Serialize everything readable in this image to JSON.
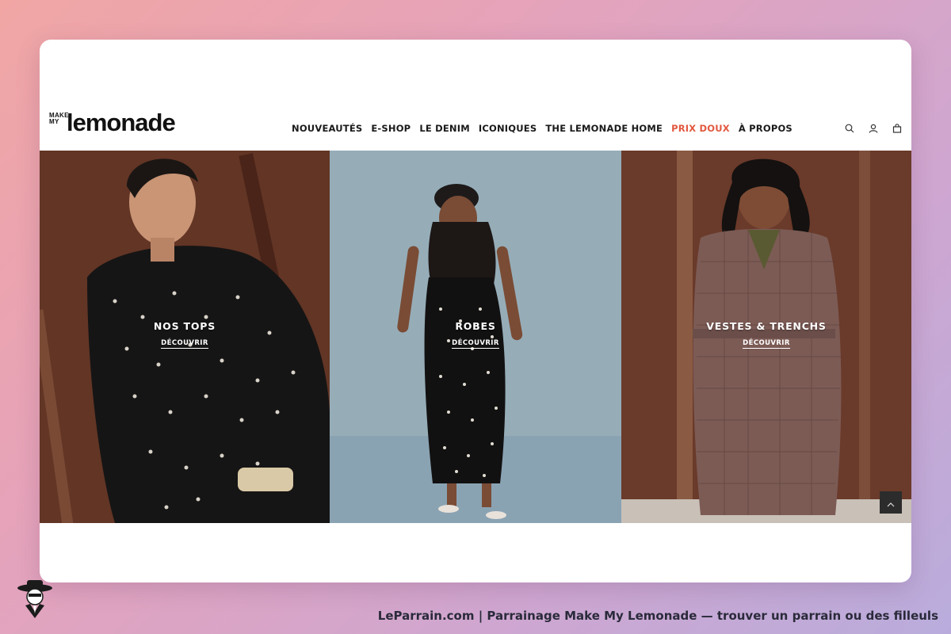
{
  "brand": {
    "logo_small_line1": "MAKE",
    "logo_small_line2": "MY",
    "logo_big": "lemonade"
  },
  "nav": {
    "items": [
      {
        "label": "NOUVEAUTÉS"
      },
      {
        "label": "E-SHOP"
      },
      {
        "label": "LE DENIM"
      },
      {
        "label": "ICONIQUES"
      },
      {
        "label": "THE LEMONADE HOME"
      },
      {
        "label": "PRIX DOUX"
      },
      {
        "label": "À PROPOS"
      }
    ],
    "accent_color": "#e2583e"
  },
  "header_icons": [
    "search-icon",
    "user-icon",
    "bag-icon"
  ],
  "hero": {
    "panels": [
      {
        "title": "NOS TOPS",
        "cta": "DÉCOUVRIR"
      },
      {
        "title": "ROBES",
        "cta": "DÉCOUVRIR"
      },
      {
        "title": "VESTES & TRENCHS",
        "cta": "DÉCOUVRIR"
      }
    ]
  },
  "footer": {
    "text": "LeParrain.com | Parrainage Make My Lemonade — trouver un parrain ou des filleuls"
  }
}
